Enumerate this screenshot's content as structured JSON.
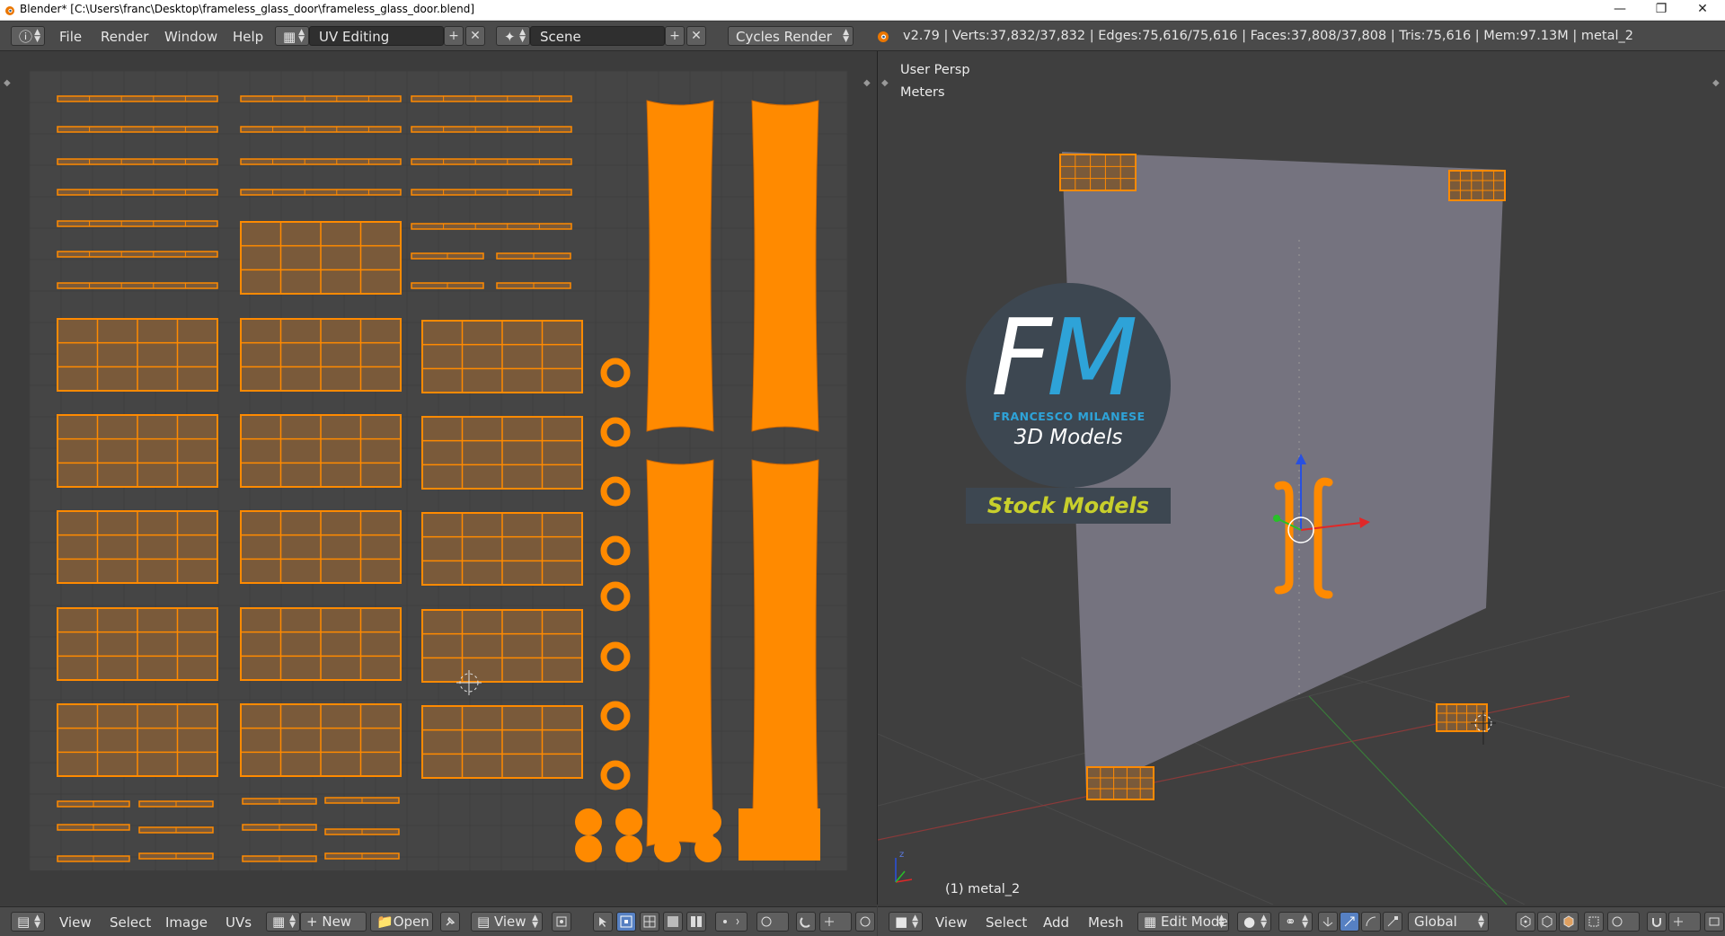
{
  "window": {
    "title": "Blender* [C:\\Users\\franc\\Desktop\\frameless_glass_door\\frameless_glass_door.blend]",
    "minimize_icon": "minimize-icon",
    "restore_icon": "restore-icon",
    "close_icon": "close-icon"
  },
  "info_header": {
    "menus": [
      "File",
      "Render",
      "Window",
      "Help"
    ],
    "screen_layout": "UV Editing",
    "scene": "Scene",
    "render_engine": "Cycles Render",
    "stats": "v2.79 | Verts:37,832/37,832 | Edges:75,616/75,616 | Faces:37,808/37,808 | Tris:75,616 | Mem:97.13M | metal_2"
  },
  "uv_editor": {
    "menus": [
      "View",
      "Select",
      "Image",
      "UVs"
    ],
    "new_label": "New",
    "open_label": "Open",
    "view_label": "View"
  },
  "viewport": {
    "view_name": "User Persp",
    "units": "Meters",
    "object_label": "(1) metal_2",
    "menus": [
      "View",
      "Select",
      "Add",
      "Mesh"
    ],
    "mode": "Edit Mode",
    "orientation": "Global"
  },
  "logo": {
    "initials_f": "F",
    "initials_m": "M",
    "name": "FRANCESCO MILANESE",
    "tagline": "3D Models",
    "banner": "Stock Models"
  },
  "colors": {
    "uv_orange": "#ff8a00",
    "island_fill": "#7a5a3a",
    "glass_panel": "#75737f",
    "accent_blue": "#2ea3d8",
    "stock_yellow": "#c8cf2c"
  }
}
